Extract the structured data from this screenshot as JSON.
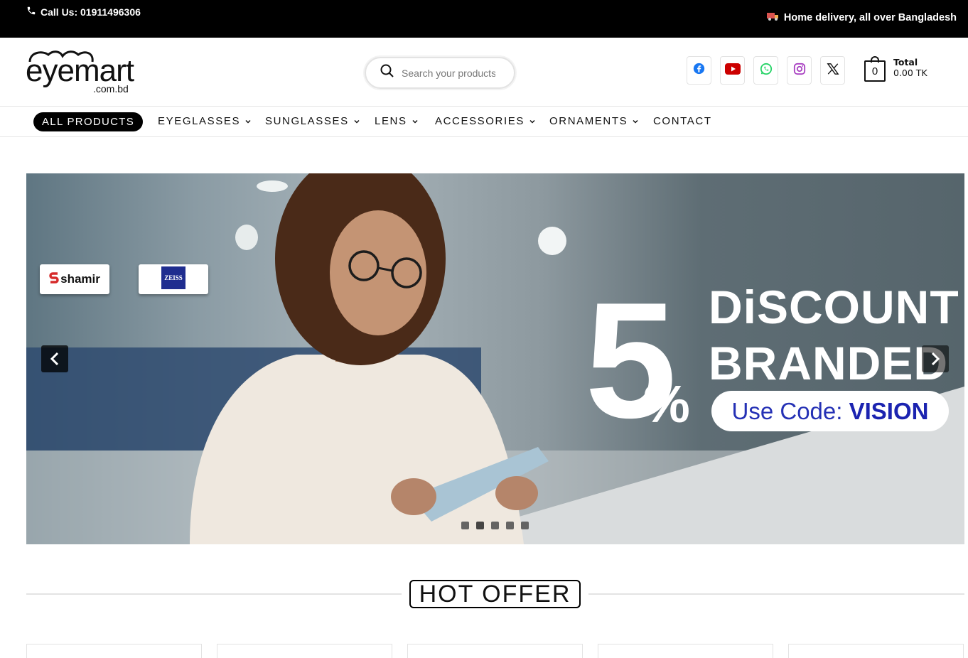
{
  "topbar": {
    "call_text": "Call Us: 01911496306",
    "delivery_text": "Home delivery, all over Bangladesh",
    "phone_icon": "phone-icon",
    "truck_icon": "truck-icon"
  },
  "header": {
    "logo_word": "eyemart",
    "logo_tld": ".com.bd",
    "search_placeholder": "Search your products",
    "socials": [
      "facebook-icon",
      "youtube-icon",
      "whatsapp-icon",
      "instagram-icon",
      "x-icon"
    ],
    "cart_count": "0",
    "total_label": "Total",
    "total_value": "0.00 TK"
  },
  "nav": {
    "all_products": "ALL PRODUCTS",
    "items": [
      "EYEGLASSES",
      "SUNGLASSES",
      "LENS",
      "ACCESSORIES",
      "ORNAMENTS",
      "CONTACT"
    ]
  },
  "hero": {
    "brand1": "shamir",
    "brand2": "ZEISS",
    "percent_number": "5",
    "percent_sign": "%",
    "headline1": "DiSCOUNT",
    "headline2": "BRANDED",
    "code_label": "Use Code:",
    "code_value": "VISION",
    "slides_total": 5,
    "active_slide": 2
  },
  "section": {
    "hot_offer": "HOT OFFER"
  },
  "colors": {
    "topbar_bg": "#000000",
    "accent_blue": "#1b23b0",
    "facebook": "#1877f2",
    "youtube": "#cc0000",
    "whatsapp": "#25d366",
    "instagram": "#a83fc1"
  }
}
